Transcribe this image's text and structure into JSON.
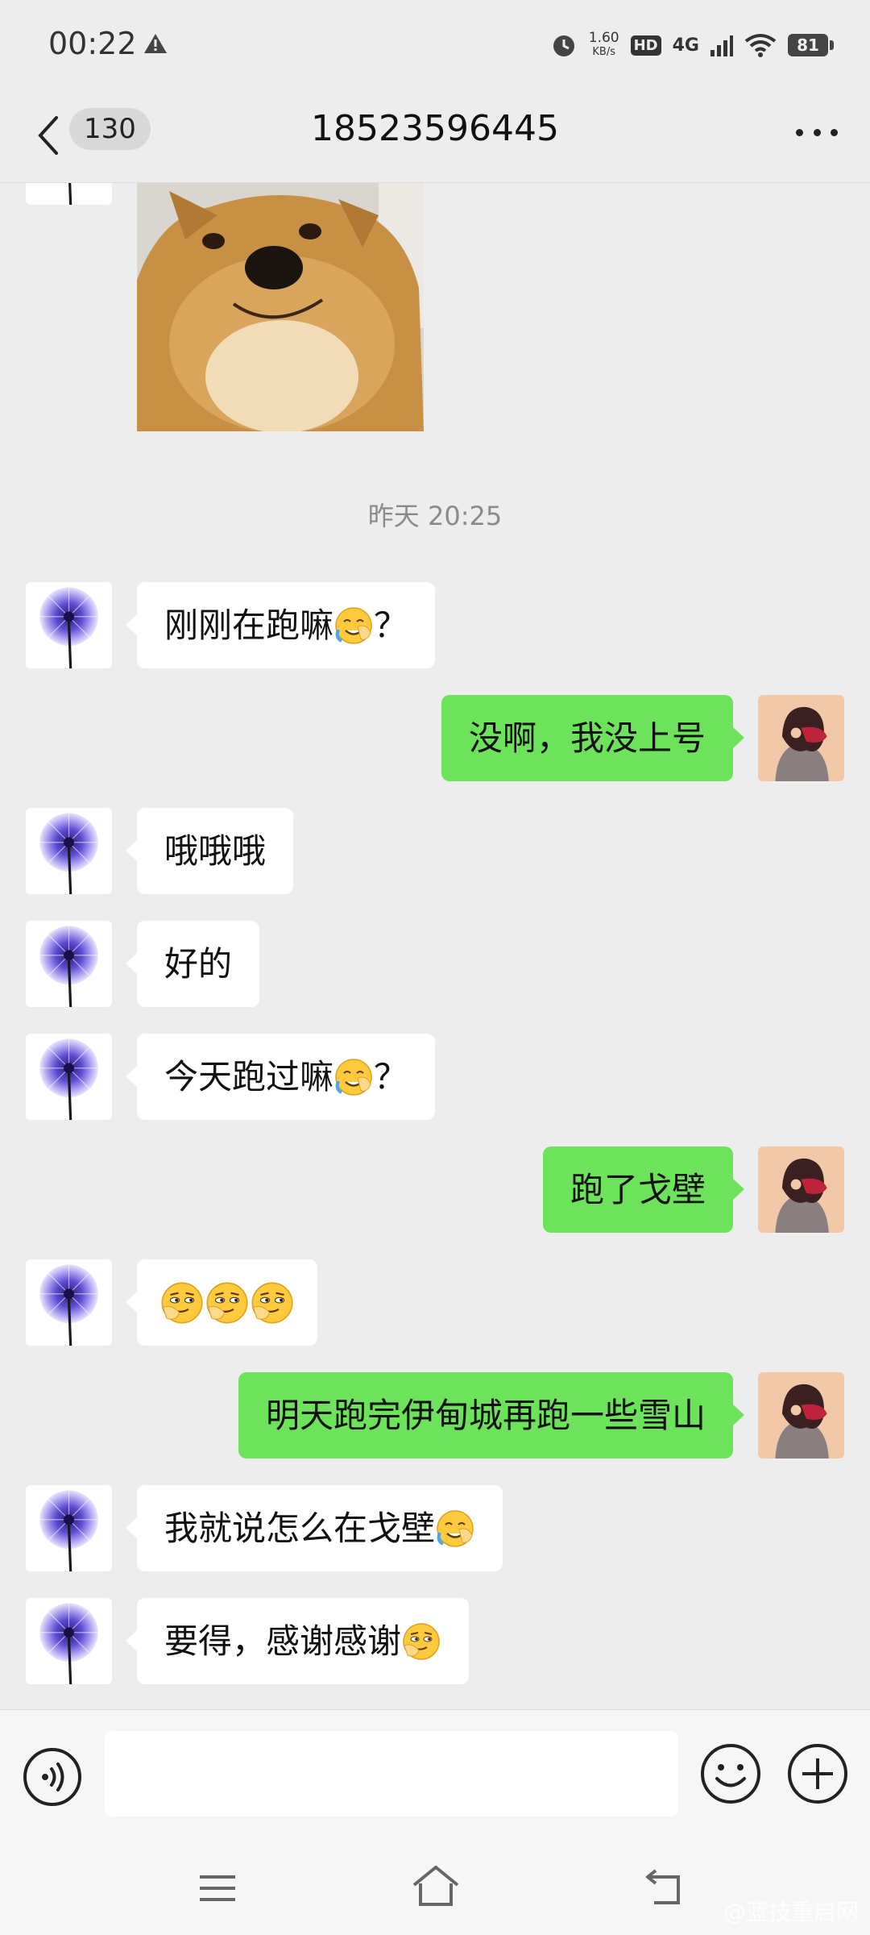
{
  "status_bar": {
    "time": "00:22",
    "speed_value": "1.60",
    "speed_unit": "KB/s",
    "hd": "HD",
    "network": "4G",
    "battery": "81"
  },
  "header": {
    "back_icon": "chevron-left-icon",
    "unread_count": "130",
    "title": "18523596445",
    "more_icon": "more-dots-icon"
  },
  "chat": {
    "timestamp": "昨天 20:25",
    "messages": [
      {
        "side": "in",
        "type": "image",
        "content": "shiba-inu-meme"
      },
      {
        "side": "in",
        "text": "刚刚在跑嘛",
        "suffix_emoji": "facepalm-cry",
        "suffix_text": "？"
      },
      {
        "side": "out",
        "text": "没啊，我没上号"
      },
      {
        "side": "in",
        "text": "哦哦哦"
      },
      {
        "side": "in",
        "text": "好的"
      },
      {
        "side": "in",
        "text": "今天跑过嘛",
        "suffix_emoji": "facepalm-cry",
        "suffix_text": "？"
      },
      {
        "side": "out",
        "text": "跑了戈壁"
      },
      {
        "side": "in",
        "emojis": [
          "smirk-hand",
          "smirk-hand",
          "smirk-hand"
        ]
      },
      {
        "side": "out",
        "text": "明天跑完伊甸城再跑一些雪山"
      },
      {
        "side": "in",
        "text": "我就说怎么在戈壁",
        "suffix_emoji": "facepalm-cry"
      },
      {
        "side": "in",
        "text": "要得，感谢感谢",
        "suffix_emoji": "smirk-hand"
      }
    ]
  },
  "input_bar": {
    "voice_icon": "voice-icon",
    "emoji_icon": "emoji-icon",
    "plus_icon": "plus-icon"
  },
  "nav_bar": {
    "icons": [
      "menu-icon",
      "home-icon",
      "back-icon"
    ],
    "watermark": "@蓝技重启网"
  },
  "colors": {
    "background": "#ededed",
    "outgoing_bubble": "#6de35b",
    "incoming_bubble": "#ffffff"
  }
}
